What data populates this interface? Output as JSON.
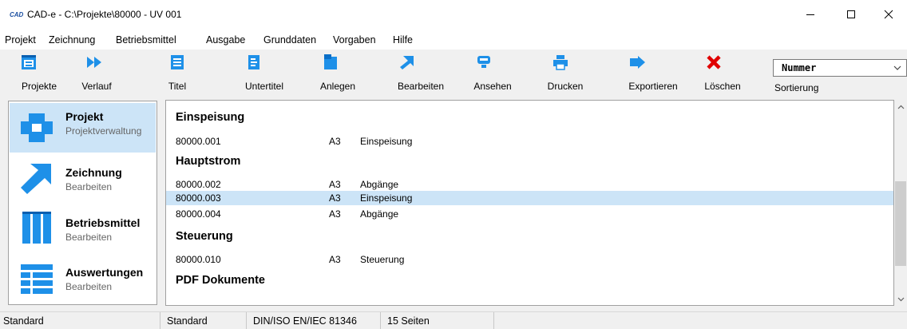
{
  "window": {
    "app_logo": "CAD",
    "title": "CAD-e - C:\\Projekte\\80000 - UV 001"
  },
  "menu": [
    "Projekt",
    "Zeichnung",
    "Betriebsmittel",
    "Ausgabe",
    "Grunddaten",
    "Vorgaben",
    "Hilfe"
  ],
  "toolbar": {
    "buttons": [
      {
        "label": "Projekte",
        "icon": "projects-icon"
      },
      {
        "label": "Verlauf",
        "icon": "history-icon"
      },
      {
        "label": "Titel",
        "icon": "title-page-icon"
      },
      {
        "label": "Untertitel",
        "icon": "subtitle-page-icon"
      },
      {
        "label": "Anlegen",
        "icon": "create-icon"
      },
      {
        "label": "Bearbeiten",
        "icon": "edit-icon"
      },
      {
        "label": "Ansehen",
        "icon": "view-icon"
      },
      {
        "label": "Drucken",
        "icon": "print-icon"
      },
      {
        "label": "Exportieren",
        "icon": "export-icon"
      },
      {
        "label": "Löschen",
        "icon": "delete-icon"
      }
    ],
    "sort": {
      "selected": "Nummer",
      "label": "Sortierung"
    }
  },
  "nav": {
    "items": [
      {
        "title": "Projekt",
        "subtitle": "Projektverwaltung",
        "icon": "project-icon",
        "active": true
      },
      {
        "title": "Zeichnung",
        "subtitle": "Bearbeiten",
        "icon": "drawing-icon",
        "active": false
      },
      {
        "title": "Betriebsmittel",
        "subtitle": "Bearbeiten",
        "icon": "equipment-icon",
        "active": false
      },
      {
        "title": "Auswertungen",
        "subtitle": "Bearbeiten",
        "icon": "reports-icon",
        "active": false
      }
    ]
  },
  "content": {
    "groups": [
      {
        "name": "Einspeisung",
        "rows": [
          {
            "number": "80000.001",
            "format": "A3",
            "description": "Einspeisung",
            "selected": false
          }
        ]
      },
      {
        "name": "Hauptstrom",
        "rows": [
          {
            "number": "80000.002",
            "format": "A3",
            "description": "Abgänge",
            "selected": false
          },
          {
            "number": "80000.003",
            "format": "A3",
            "description": "Einspeisung",
            "selected": true
          },
          {
            "number": "80000.004",
            "format": "A3",
            "description": "Abgänge",
            "selected": false
          }
        ]
      },
      {
        "name": "Steuerung",
        "rows": [
          {
            "number": "80000.010",
            "format": "A3",
            "description": "Steuerung",
            "selected": false
          }
        ]
      },
      {
        "name": "PDF Dokumente",
        "rows": []
      }
    ]
  },
  "status": [
    "Standard",
    "Standard",
    "DIN/ISO EN/IEC 81346",
    "15 Seiten"
  ],
  "colors": {
    "accent_blue": "#1e90e8",
    "selection": "#cce4f7",
    "delete_red": "#e00000"
  }
}
